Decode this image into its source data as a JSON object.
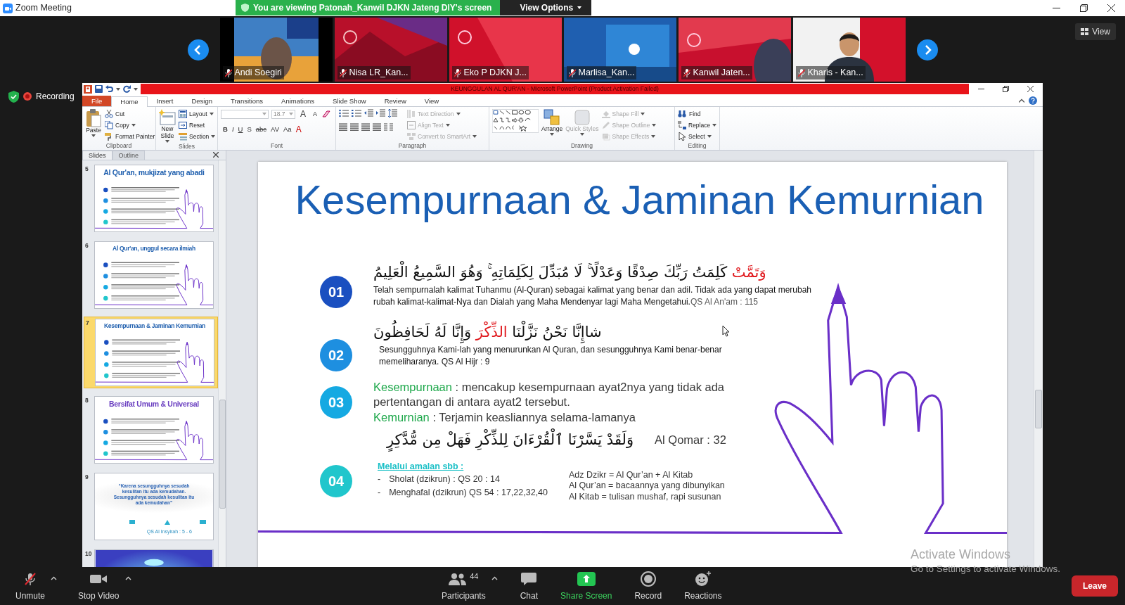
{
  "window": {
    "title": "Zoom Meeting"
  },
  "share_banner": {
    "text": "You are viewing Patonah_Kanwil DJKN Jateng DIY's screen",
    "button": "View Options"
  },
  "view_button": "View",
  "gallery": [
    {
      "name": "Andi Soegiri",
      "muted": true
    },
    {
      "name": "Nisa LR_Kan...",
      "muted": true
    },
    {
      "name": "Eko P DJKN J...",
      "muted": true
    },
    {
      "name": "Marlisa_Kan...",
      "muted": true
    },
    {
      "name": "Kanwil Jaten...",
      "muted": true
    },
    {
      "name": "Kharis - Kan...",
      "muted": true
    }
  ],
  "recording": "Recording",
  "powerpoint": {
    "title": "KEUNGGULAN AL QUR'AN - Microsoft PowerPoint (Product Activation Failed)",
    "tabs": [
      {
        "label": "File",
        "selected": false
      },
      {
        "label": "Home",
        "selected": true
      },
      {
        "label": "Insert",
        "selected": false
      },
      {
        "label": "Design",
        "selected": false
      },
      {
        "label": "Transitions",
        "selected": false
      },
      {
        "label": "Animations",
        "selected": false
      },
      {
        "label": "Slide Show",
        "selected": false
      },
      {
        "label": "Review",
        "selected": false
      },
      {
        "label": "View",
        "selected": false
      }
    ],
    "ribbon": {
      "clipboard": {
        "label": "Clipboard",
        "items": [
          {
            "label": "Paste",
            "disabled": false
          },
          {
            "label": "Cut",
            "disabled": false
          },
          {
            "label": "Copy",
            "disabled": false
          },
          {
            "label": "Format Painter",
            "disabled": false
          }
        ]
      },
      "slides": {
        "label": "Slides",
        "items": [
          {
            "label": "New Slide",
            "disabled": false
          },
          {
            "label": "Layout",
            "disabled": false
          },
          {
            "label": "Reset",
            "disabled": false
          },
          {
            "label": "Section",
            "disabled": false
          }
        ]
      },
      "font": {
        "label": "Font",
        "size": "18.7",
        "resize": [
          "A",
          "A"
        ],
        "styles": [
          "B",
          "I",
          "U",
          "S",
          "abc",
          "AV",
          "Aa",
          "A"
        ]
      },
      "paragraph": {
        "label": "Paragraph",
        "items": [
          {
            "label": "Text Direction",
            "disabled": true
          },
          {
            "label": "Align Text",
            "disabled": true
          },
          {
            "label": "Convert to SmartArt",
            "disabled": true
          }
        ]
      },
      "drawing": {
        "label": "Drawing",
        "items": [
          {
            "label": "Arrange",
            "disabled": false
          },
          {
            "label": "Quick Styles",
            "disabled": true
          },
          {
            "label": "Shape Fill",
            "disabled": true
          },
          {
            "label": "Shape Outline",
            "disabled": true
          },
          {
            "label": "Shape Effects",
            "disabled": true
          }
        ]
      },
      "editing": {
        "label": "Editing",
        "items": [
          {
            "label": "Find",
            "disabled": false
          },
          {
            "label": "Replace",
            "disabled": false
          },
          {
            "label": "Select",
            "disabled": false
          }
        ]
      }
    },
    "pane_tabs": [
      {
        "label": "Slides",
        "selected": true
      },
      {
        "label": "Outline",
        "selected": false
      }
    ],
    "slides": [
      {
        "number": "5",
        "kind": "content",
        "title": "Al Qur'an, mukjizat yang abadi",
        "color": "#1f5fae",
        "selected": false
      },
      {
        "number": "6",
        "kind": "content",
        "title": "Al Qur'an, unggul secara ilmiah",
        "color": "#1f5fae",
        "selected": false
      },
      {
        "number": "7",
        "kind": "content",
        "title": "Kesempurnaan & Jaminan Kemurnian",
        "color": "#1f5fae",
        "selected": true
      },
      {
        "number": "8",
        "kind": "content",
        "title": "Bersifat Umum & Universal",
        "color": "#6a3fc0",
        "selected": false
      },
      {
        "number": "9",
        "kind": "quote",
        "quote": "“Karena sesungguhnya sesudah kesulitan itu ada kemudahan. Sesungguhnya sesudah kesulitan itu ada kemudahan”",
        "reference": "QS Al Insyirah : 5 - 6",
        "selected": false
      },
      {
        "number": "10",
        "kind": "picture",
        "selected": false
      }
    ],
    "slide": {
      "title": "Kesempurnaan & Jaminan Kemurnian",
      "points": [
        {
          "number": "01",
          "color": "#1a4fc0",
          "kind": "verse",
          "arabic": [
            {
              "text": "وَتَمَّتْ",
              "highlight": true
            },
            {
              "text": " كَلِمَتُ رَبِّكَ صِدْقًا وَعَدْلًا ۚ لَا مُبَدِّلَ لِكَلِمَاتِهِ ۚ وَهُوَ السَّمِيعُ الْعَلِيمُ",
              "highlight": false
            }
          ],
          "translation": "Telah sempurnalah kalimat Tuhanmu (Al-Quran) sebagai kalimat yang benar dan adil. Tidak ada yang dapat merubah rubah kalimat-kalimat-Nya  dan Dialah yang Maha Mendenyar lagi Maha Mengetahui.",
          "reference": "QS Al An'am : 115"
        },
        {
          "number": "02",
          "color": "#1e8fe0",
          "kind": "verse",
          "arabic": [
            {
              "text": "شاإِنَّا نَحْنُ نَزَّلْنَا ",
              "highlight": false
            },
            {
              "text": "الذِّكْرَ",
              "highlight": true
            },
            {
              "text": " وَإِنَّا لَهُ لَحَافِظُونَ",
              "highlight": false
            }
          ],
          "translation": "Sesungguhnya Kami-lah yang menurunkan Al Quran, dan sesungguhnya Kami benar-benar memeliharanya. QS Al Hijr : 9"
        },
        {
          "number": "03",
          "color": "#15a9e2",
          "kind": "definitions",
          "definitions": [
            {
              "term": "Kesempurnaan",
              "text": " : mencakup kesempurnaan ayat2nya yang tidak ada pertentangan di antara ayat2 tersebut."
            },
            {
              "term": "Kemurnian",
              "text": " : Terjamin keasliannya selama-lamanya"
            }
          ],
          "arabic": [
            {
              "text": "وَلَقَدْ يَسَّرْنَا ٱلْقُرْءَانَ لِلذِّكْرِ فَهَلْ مِن مُّدَّكِرٍ",
              "highlight": false
            }
          ],
          "reference": "Al Qomar : 32"
        },
        {
          "number": "04",
          "color": "#20c6cc",
          "kind": "practice",
          "heading": "Melalui amalan sbb :",
          "list": [
            {
              "marker": "-",
              "text": "Sholat (dzikrun) : QS 20 : 14"
            },
            {
              "marker": "-",
              "text": "Menghafal (dzikrun) QS 54 : 17,22,32,40"
            }
          ],
          "notes": [
            "Adz Dzikr = Al Qur’an + Al Kitab",
            "Al Qur’an = bacaannya yang dibunyikan",
            "Al Kitab = tulisan mushaf, rapi susunan"
          ]
        }
      ]
    }
  },
  "toolbar": {
    "items": [
      {
        "label": "Unmute",
        "kind": "mic",
        "muted": true,
        "caret": true
      },
      {
        "label": "Stop Video",
        "kind": "video",
        "caret": true
      },
      {
        "label": "Participants",
        "kind": "participants",
        "count": "44",
        "caret": true
      },
      {
        "label": "Chat",
        "kind": "chat",
        "caret": false
      },
      {
        "label": "Share Screen",
        "kind": "share",
        "caret": false
      },
      {
        "label": "Record",
        "kind": "record",
        "caret": false
      },
      {
        "label": "Reactions",
        "kind": "reactions",
        "caret": false
      }
    ],
    "leave": "Leave"
  },
  "activation": {
    "title": "Activate Windows",
    "hint": "Go to Settings to activate Windows."
  }
}
